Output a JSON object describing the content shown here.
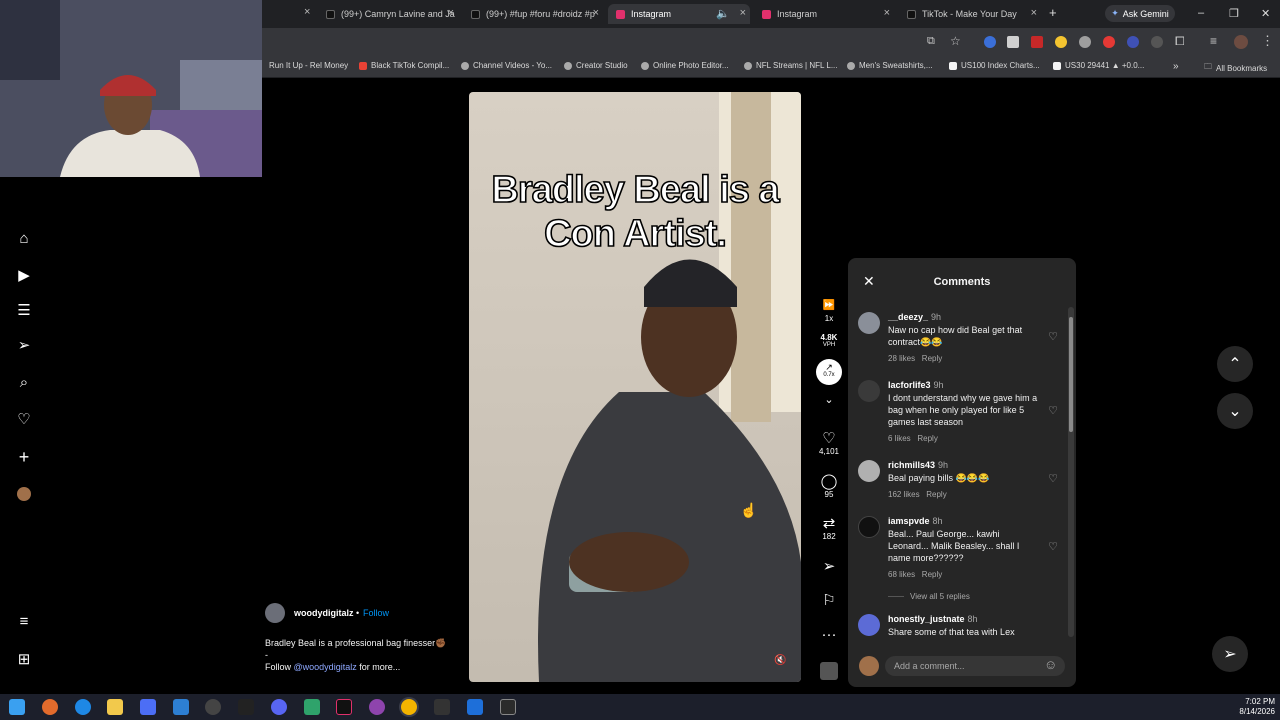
{
  "browser": {
    "tabs": [
      {
        "label": "(99+) Camryn Lavine and Ja",
        "favicon_color": "#111111"
      },
      {
        "label": "(99+) #fup #foru #droidz #p",
        "favicon_color": "#111111"
      },
      {
        "label": "Instagram",
        "favicon_color": "#e1306c"
      },
      {
        "label": "Instagram",
        "favicon_color": "#e1306c"
      },
      {
        "label": "TikTok - Make Your Day",
        "favicon_color": "#111111"
      }
    ],
    "new_tab_label": "+",
    "ask_gemini_label": "Ask Gemini",
    "bookmarks": [
      {
        "label": "Run It Up - Rel Money",
        "color": "#e94235"
      },
      {
        "label": "Black TikTok Compil...",
        "color": "#e94235"
      },
      {
        "label": "Channel Videos - Yo...",
        "color": "#aaaaaa"
      },
      {
        "label": "Creator Studio",
        "color": "#aaaaaa"
      },
      {
        "label": "Online Photo Editor...",
        "color": "#aaaaaa"
      },
      {
        "label": "NFL Streams | NFL L...",
        "color": "#aaaaaa"
      },
      {
        "label": "Men's Sweatshirts,...",
        "color": "#aaaaaa"
      },
      {
        "label": "US100 Index Charts...",
        "color": "#f5f5f5"
      },
      {
        "label": "US30 29441 ▲ +0.0...",
        "color": "#f5f5f5"
      }
    ],
    "bookmarks_more": "»",
    "all_bookmarks_label": "All Bookmarks"
  },
  "instagram": {
    "video_caption_overlay": "Bradley Beal is a Con Artist.",
    "actions": {
      "speed_label": "1x",
      "vph_value": "4.8K",
      "vph_unit": "VPH",
      "trend_value": "0.7x",
      "likes_count": "4,101",
      "comments_count": "95",
      "reposts_count": "182"
    },
    "comments_panel": {
      "title": "Comments",
      "comments": [
        {
          "user": "__deezy_",
          "time": "9h",
          "text": "Naw no cap how did Beal get that contract😂😂",
          "likes": "28 likes",
          "reply": "Reply",
          "avatar_color": "#8a8f99"
        },
        {
          "user": "lacforlife3",
          "time": "9h",
          "text": "I dont understand why we gave him a bag when he only played for like 5 games last season",
          "likes": "6 likes",
          "reply": "Reply",
          "avatar_color": "#3a3a3a"
        },
        {
          "user": "richmills43",
          "time": "9h",
          "text": "Beal paying bills 😂😂😂",
          "likes": "162 likes",
          "reply": "Reply",
          "avatar_color": "#b0b0b0"
        },
        {
          "user": "iamspvde",
          "time": "8h",
          "text": "Beal... Paul George... kawhi Leonard... Malik Beasley... shall I name more??????",
          "likes": "68 likes",
          "reply": "Reply",
          "avatar_color": "#111111"
        },
        {
          "user": "honestly_justnate",
          "time": "8h",
          "text": "Share some of that tea with Lex",
          "likes": "",
          "reply": "",
          "avatar_color": "#5c6bd6"
        }
      ],
      "view_replies_label": "View all 5 replies",
      "add_comment_placeholder": "Add a comment..."
    },
    "post": {
      "username": "woodydigitalz",
      "follow_label": "Follow",
      "separator": "•",
      "description": "Bradley Beal is a professional bag finesser✊🏾",
      "dash": "-",
      "follow_prefix": "Follow",
      "mention": "@woodydigitalz",
      "follow_suffix": "for more..."
    }
  },
  "taskbar": {
    "time": "7:02 PM",
    "date": "8/14/2026"
  },
  "colors": {
    "accent_blue": "#0095f6",
    "mention_blue": "#8ea8ff",
    "panel_bg": "#262626",
    "chrome_dark": "#202124",
    "chrome_toolbar": "#35363a"
  }
}
